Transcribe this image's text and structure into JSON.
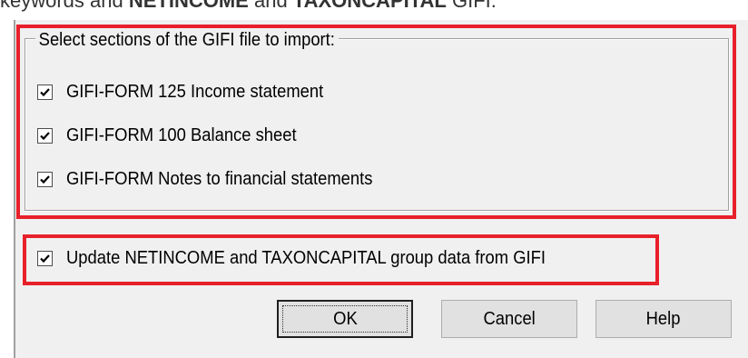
{
  "doc": {
    "prefix": "keywords and ",
    "bold1": "NETINCOME",
    "middle": " and ",
    "bold2": "TAXONCAPITAL",
    "suffix": " GIFI."
  },
  "dialog": {
    "group_title": "Select sections of the GIFI file to import:",
    "sections": [
      {
        "label": "GIFI-FORM  125 Income statement",
        "checked": true
      },
      {
        "label": "GIFI-FORM  100 Balance sheet",
        "checked": true
      },
      {
        "label": "GIFI-FORM  Notes to financial statements",
        "checked": true
      }
    ],
    "update_option": {
      "label": "Update NETINCOME and TAXONCAPITAL group data from GIFI",
      "checked": true
    },
    "buttons": {
      "ok": "OK",
      "cancel": "Cancel",
      "help": "Help"
    }
  },
  "colors": {
    "highlight": "#e8202a",
    "dialog_bg": "#f0f0f0",
    "button_bg": "#e1e1e1"
  }
}
